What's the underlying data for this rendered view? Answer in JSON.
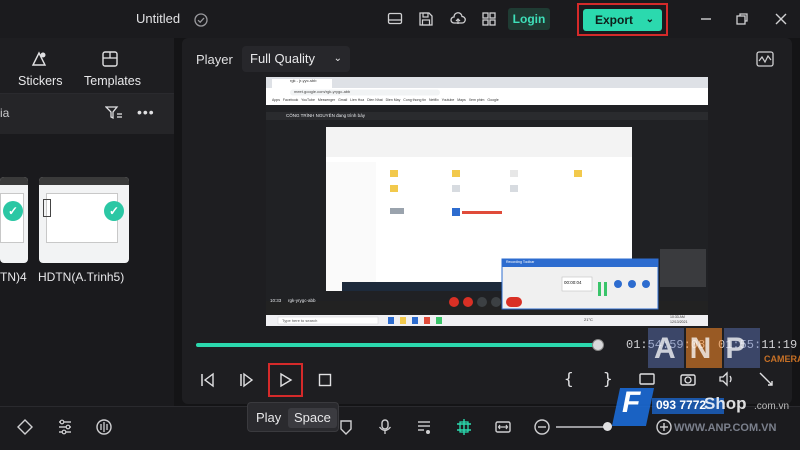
{
  "titlebar": {
    "title": "Untitled",
    "login_label": "Login",
    "export_label": "Export"
  },
  "left_panel": {
    "tabs": [
      {
        "label": "Stickers",
        "icon": "stickers-icon"
      },
      {
        "label": "Templates",
        "icon": "templates-icon"
      }
    ],
    "sub_label": "ia",
    "clips": [
      {
        "label": "TN)4"
      },
      {
        "label": "HDTN(A.Trinh5)"
      }
    ]
  },
  "player": {
    "label": "Player",
    "quality": "Full Quality",
    "current_time": "01:54:59:08",
    "total_time": "01:55:11:19",
    "progress": 0.995
  },
  "screen": {
    "tab_title": "rgk - jr-yyc-sbb",
    "url": "meet.google.com/rgk-yrygc-abb",
    "bookmarks": [
      "Apps",
      "Facebook",
      "YouTube",
      "Messenger",
      "Gmail",
      "Lien Hoa",
      "Dien Nhat",
      "Dien May",
      "Cong thong tin",
      "Netflix",
      "Youtube",
      "Maps",
      "Xem phim",
      "Google"
    ],
    "meeting_banner": "CÔNG TRÌNH NGUYÊN đang trình bày",
    "meet_time": "10:33",
    "meet_code": "rgk-yrygc-abb",
    "search_placeholder": "Type here to search",
    "recording_title": "Recording Toolbar",
    "recording_time": "00:00:04",
    "clock_time": "10:33 AM",
    "clock_date": "12/13/2021",
    "weather": "21°C"
  },
  "tooltip": {
    "label": "Play",
    "shortcut": "Space"
  },
  "watermark": {
    "brand": "ANP",
    "line1": "CAMERA",
    "shop": "Shop",
    "domain": ".com.vn",
    "site": "WWW.ANP.COM.VN",
    "phone": "093 7772"
  },
  "colors": {
    "accent": "#2bd9ae",
    "highlight": "#d52a2a",
    "background": "#141416"
  }
}
